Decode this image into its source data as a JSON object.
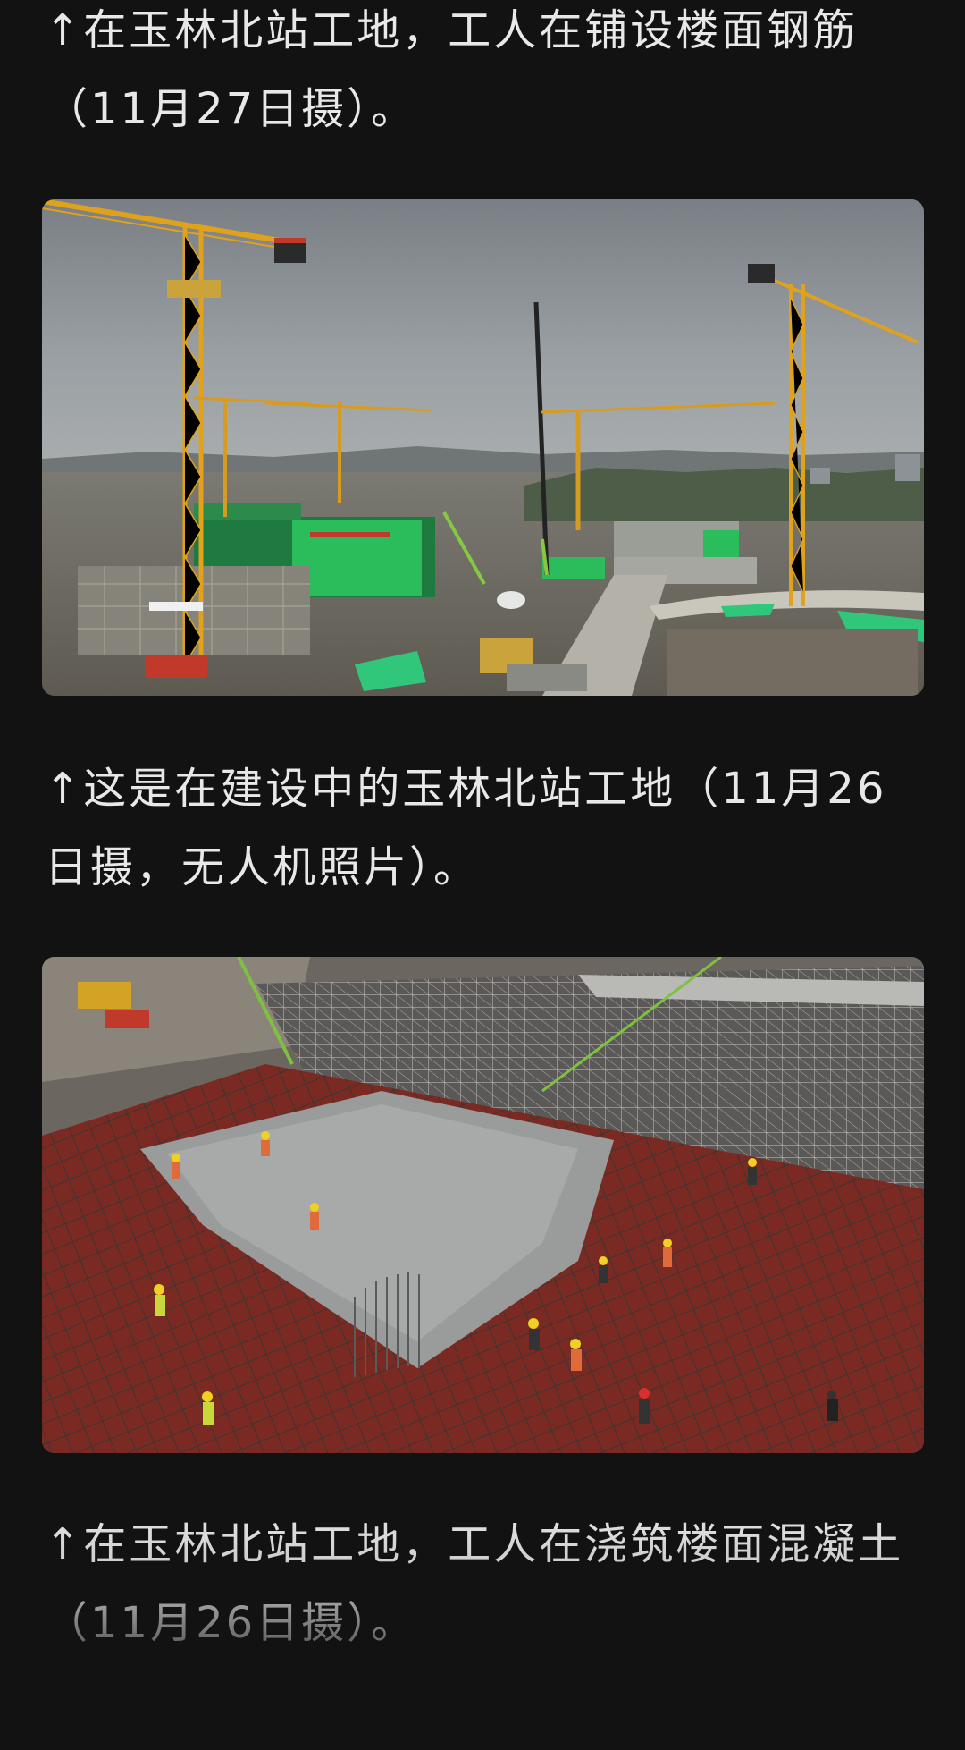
{
  "article": {
    "captions": [
      "↑在玉林北站工地，工人在铺设楼面钢筋（11月27日摄）。",
      "↑这是在建设中的玉林北站工地（11月26日摄，无人机照片）。",
      "↑在玉林北站工地，工人在浇筑楼面混凝土（11月26日摄）。"
    ],
    "photos": [
      {
        "icon": "construction-site-aerial-photo"
      },
      {
        "icon": "concrete-pouring-photo"
      }
    ]
  },
  "colors": {
    "background": "#121212",
    "text": "#e8e8e8",
    "crane": "#e0a21c",
    "green_mesh": "#2dbd6e",
    "rebar_red": "#8c2f24"
  }
}
